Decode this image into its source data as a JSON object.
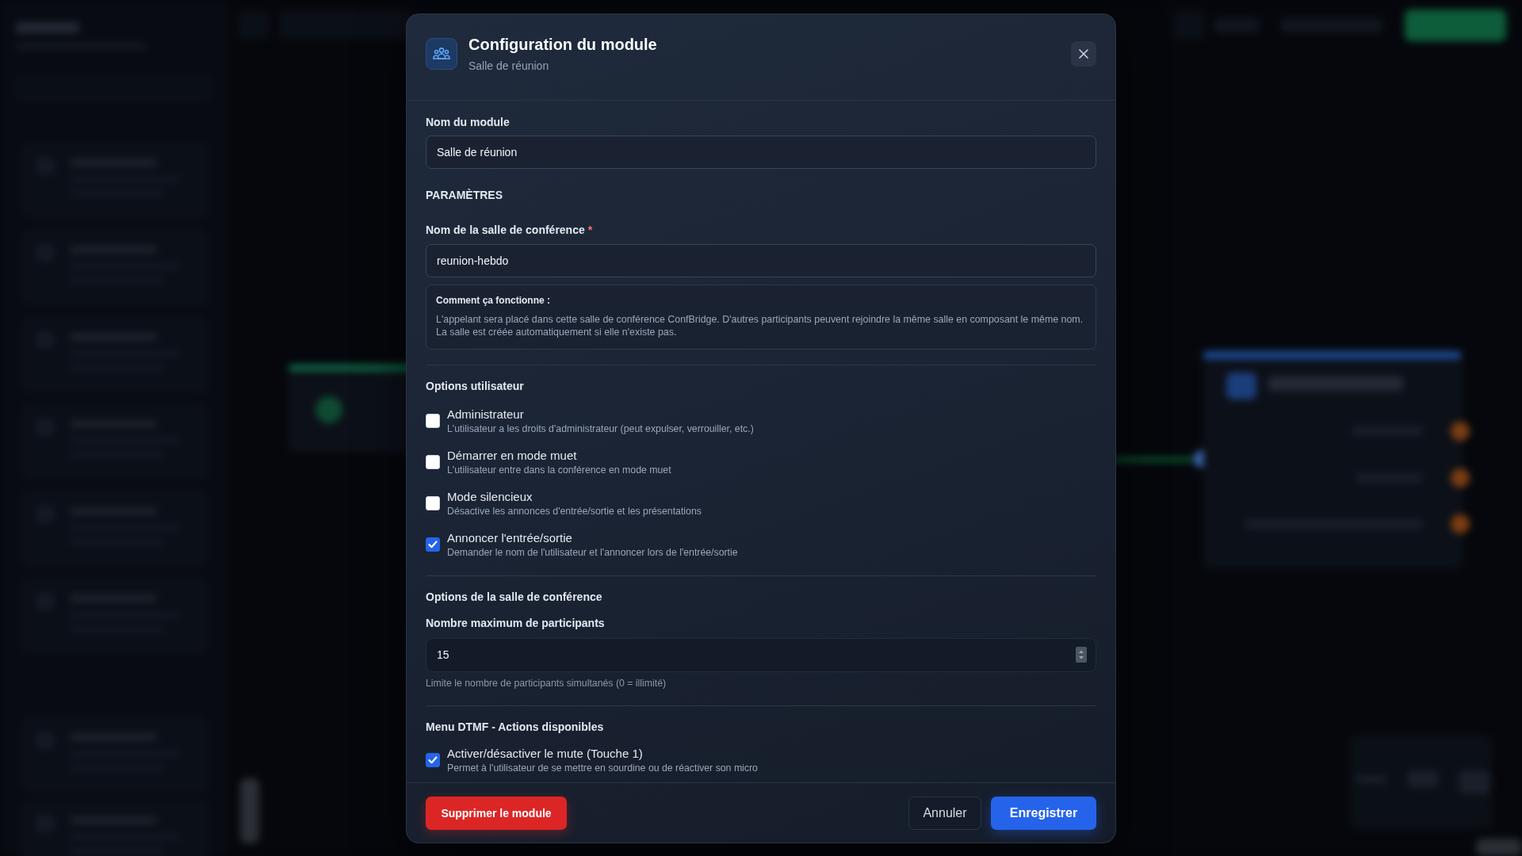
{
  "modal": {
    "title": "Configuration du module",
    "subtitle": "Salle de réunion"
  },
  "module_name": {
    "label": "Nom du module",
    "value": "Salle de réunion"
  },
  "parameters": {
    "heading": "PARAMÈTRES",
    "room_name": {
      "label": "Nom de la salle de conférence",
      "required_mark": "*",
      "value": "reunion-hebdo"
    },
    "info": {
      "title": "Comment ça fonctionne :",
      "text": "L'appelant sera placé dans cette salle de conférence ConfBridge. D'autres participants peuvent rejoindre la même salle en composant le même nom. La salle est créée automatiquement si elle n'existe pas."
    }
  },
  "user_options": {
    "heading": "Options utilisateur",
    "items": [
      {
        "label": "Administrateur",
        "description": "L'utilisateur a les droits d'administrateur (peut expulser, verrouiller, etc.)",
        "checked": false
      },
      {
        "label": "Démarrer en mode muet",
        "description": "L'utilisateur entre dans la conférence en mode muet",
        "checked": false
      },
      {
        "label": "Mode silencieux",
        "description": "Désactive les annonces d'entrée/sortie et les présentations",
        "checked": false
      },
      {
        "label": "Annoncer l'entrée/sortie",
        "description": "Demander le nom de l'utilisateur et l'annoncer lors de l'entrée/sortie",
        "checked": true
      }
    ]
  },
  "room_options": {
    "heading": "Options de la salle de conférence",
    "max_participants": {
      "label": "Nombre maximum de participants",
      "value": "15",
      "hint": "Limite le nombre de participants simultanés (0 = illimité)"
    }
  },
  "dtmf_menu": {
    "heading": "Menu DTMF - Actions disponibles",
    "items": [
      {
        "label": "Activer/désactiver le mute (Touche 1)",
        "description": "Permet à l'utilisateur de se mettre en sourdine ou de réactiver son micro",
        "checked": true
      }
    ]
  },
  "footer": {
    "delete_button": "Supprimer le module",
    "cancel_button": "Annuler",
    "save_button": "Enregistrer"
  }
}
